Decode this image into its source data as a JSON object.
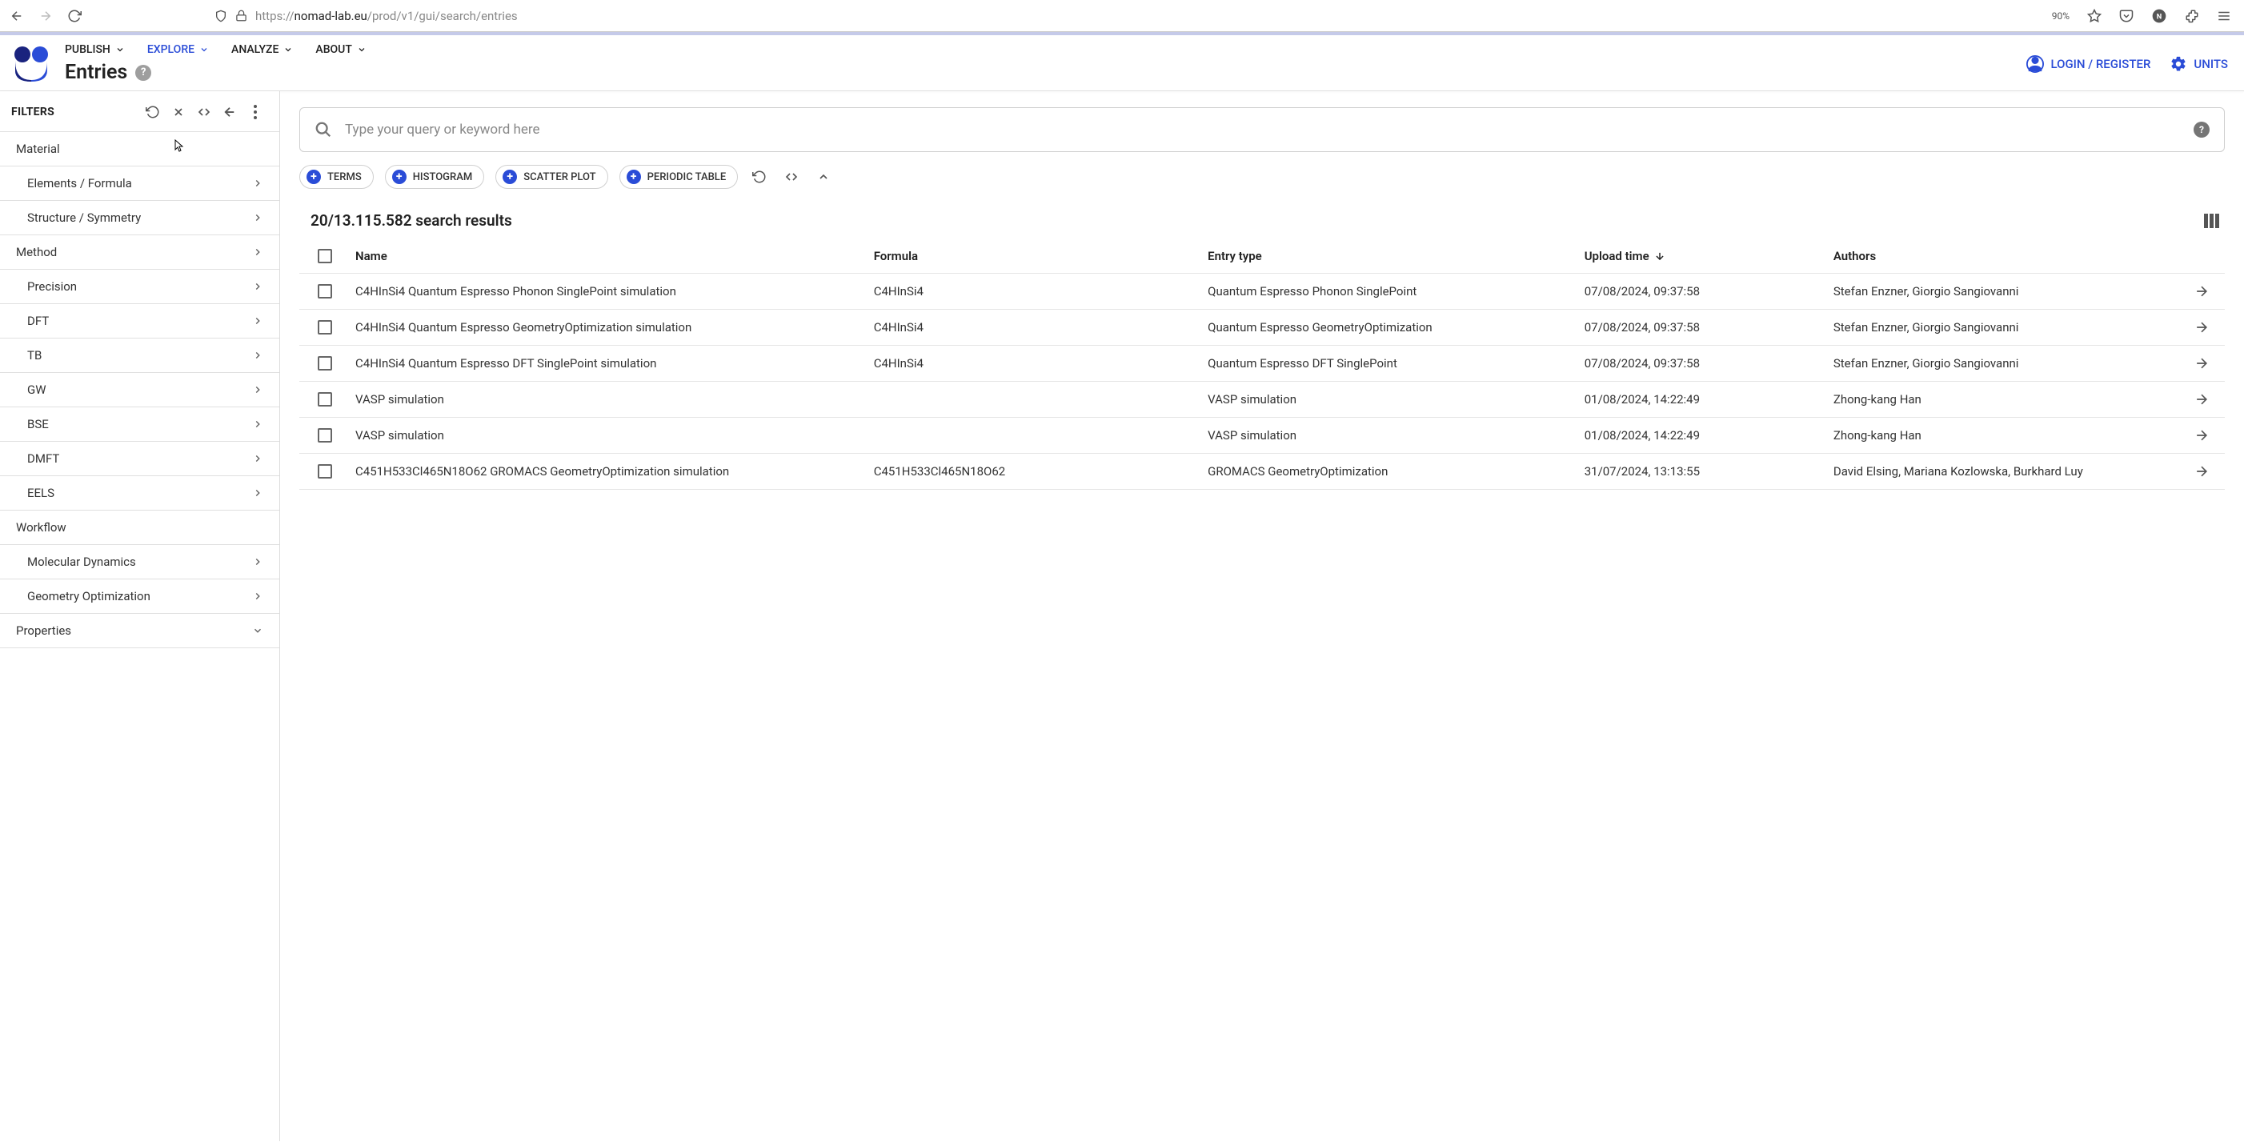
{
  "browser": {
    "url_gray_prefix": "https://",
    "url_dark": "nomad-lab.eu",
    "url_gray_suffix": "/prod/v1/gui/search/entries",
    "zoom": "90%"
  },
  "nav": {
    "items": [
      {
        "label": "PUBLISH",
        "active": false
      },
      {
        "label": "EXPLORE",
        "active": true
      },
      {
        "label": "ANALYZE",
        "active": false
      },
      {
        "label": "ABOUT",
        "active": false
      }
    ]
  },
  "page": {
    "title": "Entries",
    "login": "LOGIN / REGISTER",
    "units": "UNITS"
  },
  "filters": {
    "label": "FILTERS",
    "sections": [
      {
        "title": "Material",
        "collapsible": false,
        "items": [
          {
            "label": "Elements / Formula"
          },
          {
            "label": "Structure / Symmetry"
          }
        ]
      },
      {
        "title": "Method",
        "collapsible": true,
        "items": [
          {
            "label": "Precision"
          },
          {
            "label": "DFT"
          },
          {
            "label": "TB"
          },
          {
            "label": "GW"
          },
          {
            "label": "BSE"
          },
          {
            "label": "DMFT"
          },
          {
            "label": "EELS"
          }
        ]
      },
      {
        "title": "Workflow",
        "collapsible": false,
        "items": [
          {
            "label": "Molecular Dynamics"
          },
          {
            "label": "Geometry Optimization"
          }
        ]
      },
      {
        "title": "Properties",
        "collapsible": true,
        "items": []
      }
    ]
  },
  "search": {
    "placeholder": "Type your query or keyword here"
  },
  "chips": [
    {
      "label": "TERMS"
    },
    {
      "label": "HISTOGRAM"
    },
    {
      "label": "SCATTER PLOT"
    },
    {
      "label": "PERIODIC TABLE"
    }
  ],
  "results": {
    "summary": "20/13.115.582 search results",
    "columns": {
      "name": "Name",
      "formula": "Formula",
      "entry_type": "Entry type",
      "upload_time": "Upload time",
      "authors": "Authors"
    },
    "rows": [
      {
        "name": "C4HInSi4 Quantum Espresso Phonon SinglePoint simulation",
        "formula": "C4HInSi4",
        "entry_type": "Quantum Espresso Phonon SinglePoint",
        "upload_time": "07/08/2024, 09:37:58",
        "authors": "Stefan Enzner, Giorgio Sangiovanni"
      },
      {
        "name": "C4HInSi4 Quantum Espresso GeometryOptimization simulation",
        "formula": "C4HInSi4",
        "entry_type": "Quantum Espresso GeometryOptimization",
        "upload_time": "07/08/2024, 09:37:58",
        "authors": "Stefan Enzner, Giorgio Sangiovanni"
      },
      {
        "name": "C4HInSi4 Quantum Espresso DFT SinglePoint simulation",
        "formula": "C4HInSi4",
        "entry_type": "Quantum Espresso DFT SinglePoint",
        "upload_time": "07/08/2024, 09:37:58",
        "authors": "Stefan Enzner, Giorgio Sangiovanni"
      },
      {
        "name": "VASP simulation",
        "formula": "",
        "entry_type": "VASP simulation",
        "upload_time": "01/08/2024, 14:22:49",
        "authors": "Zhong-kang Han"
      },
      {
        "name": "VASP simulation",
        "formula": "",
        "entry_type": "VASP simulation",
        "upload_time": "01/08/2024, 14:22:49",
        "authors": "Zhong-kang Han"
      },
      {
        "name": "C451H533Cl465N18O62 GROMACS GeometryOptimization simulation",
        "formula": "C451H533Cl465N18O62",
        "entry_type": "GROMACS GeometryOptimization",
        "upload_time": "31/07/2024, 13:13:55",
        "authors": "David Elsing, Mariana Kozlowska, Burkhard Luy"
      }
    ]
  }
}
